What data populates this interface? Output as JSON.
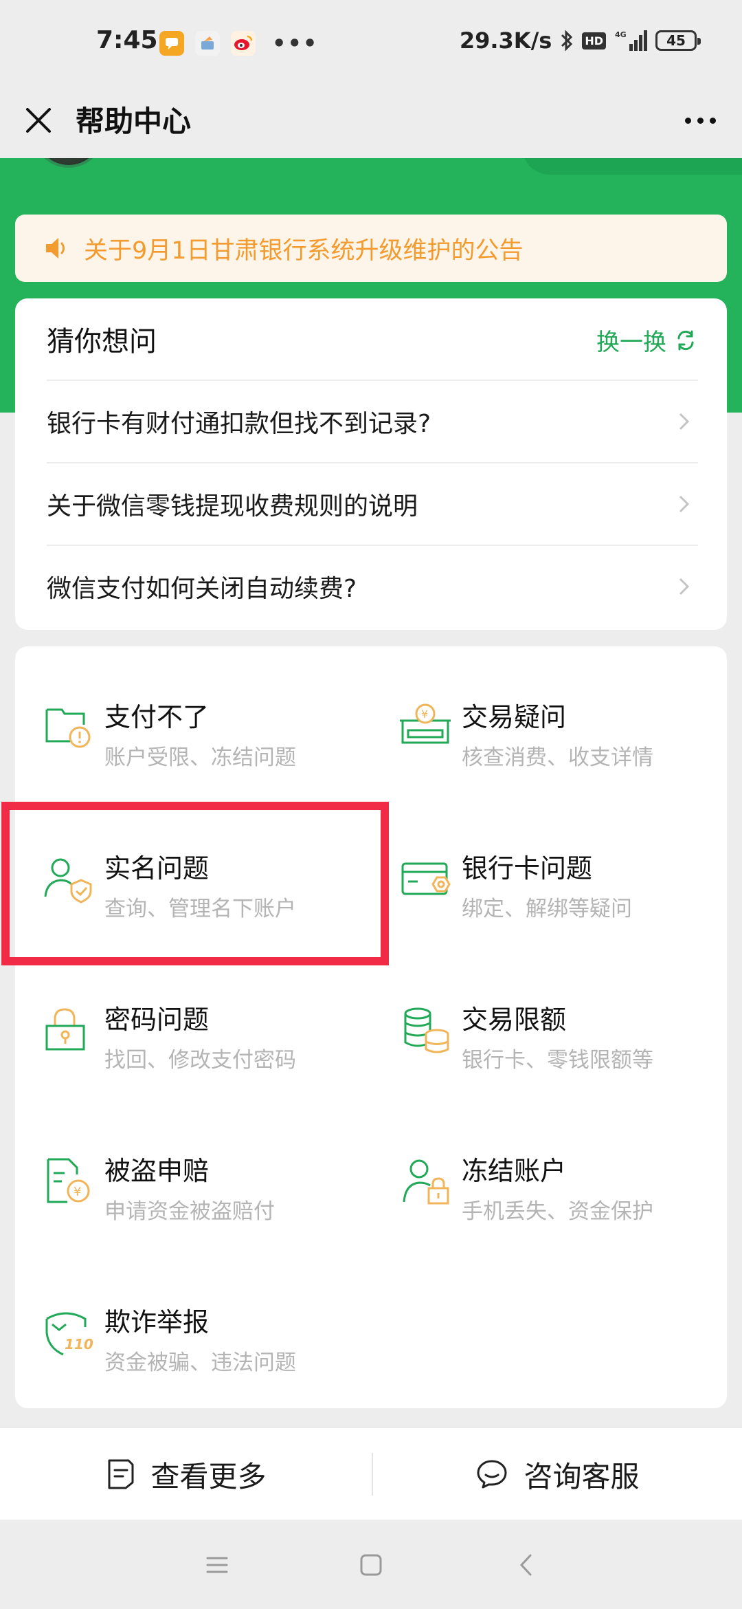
{
  "status_bar": {
    "time": "7:45",
    "notification_icons": [
      "chat-bubble-icon",
      "app-icon",
      "weibo-icon"
    ],
    "more_dots": "•••",
    "net_speed": "29.3K/s",
    "hd": "HD",
    "signal": "4G",
    "battery": "45"
  },
  "titlebar": {
    "title": "帮助中心"
  },
  "announcement": {
    "text": "关于9月1日甘肃银行系统升级维护的公告"
  },
  "guess": {
    "title": "猜你想问",
    "refresh_label": "换一换",
    "questions": [
      "银行卡有财付通扣款但找不到记录?",
      "关于微信零钱提现收费规则的说明",
      "微信支付如何关闭自动续费?"
    ]
  },
  "categories": [
    {
      "title": "支付不了",
      "subtitle": "账户受限、冻结问题",
      "icon": "payment-failed-icon"
    },
    {
      "title": "交易疑问",
      "subtitle": "核查消费、收支详情",
      "icon": "transaction-question-icon"
    },
    {
      "title": "实名问题",
      "subtitle": "查询、管理名下账户",
      "icon": "real-name-icon"
    },
    {
      "title": "银行卡问题",
      "subtitle": "绑定、解绑等疑问",
      "icon": "bank-card-icon"
    },
    {
      "title": "密码问题",
      "subtitle": "找回、修改支付密码",
      "icon": "password-lock-icon"
    },
    {
      "title": "交易限额",
      "subtitle": "银行卡、零钱限额等",
      "icon": "coin-stack-icon"
    },
    {
      "title": "被盗申赔",
      "subtitle": "申请资金被盗赔付",
      "icon": "claim-document-icon"
    },
    {
      "title": "冻结账户",
      "subtitle": "手机丢失、资金保护",
      "icon": "freeze-account-icon"
    },
    {
      "title": "欺诈举报",
      "subtitle": "资金被骗、违法问题",
      "icon": "fraud-report-icon"
    }
  ],
  "actions": {
    "more_label": "查看更多",
    "service_label": "咨询客服"
  },
  "colors": {
    "brand_green": "#24b35b",
    "announce_orange": "#f39b2f",
    "icon_green": "#22a957",
    "icon_orange": "#f1b559",
    "highlight_red": "#f12a45"
  }
}
